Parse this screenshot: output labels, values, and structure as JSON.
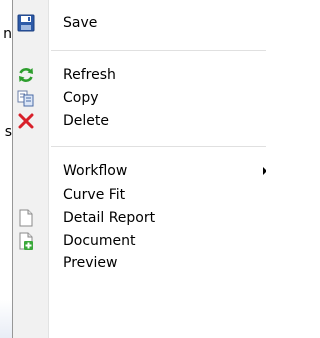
{
  "background": {
    "fragment_1": "n",
    "fragment_2": "s"
  },
  "menu": {
    "items": [
      {
        "label": "Save",
        "icon": "save-disk-icon"
      },
      {
        "label": "Refresh",
        "icon": "refresh-icon"
      },
      {
        "label": "Copy",
        "icon": "copy-icon"
      },
      {
        "label": "Delete",
        "icon": "delete-x-icon"
      },
      {
        "label": "Workflow",
        "icon": "",
        "has_submenu": true
      },
      {
        "label": "Curve Fit",
        "icon": ""
      },
      {
        "label": "Detail Report",
        "icon": "page-icon"
      },
      {
        "label": "Document",
        "icon": "add-document-icon"
      },
      {
        "label": "Preview",
        "icon": ""
      }
    ]
  },
  "colors": {
    "gutter": "#f1f1f1",
    "border": "#979797",
    "separator": "#e0e0e0",
    "refresh_green": "#2e9e2e",
    "delete_red": "#d8202a",
    "save_blue": "#2c5aa8"
  }
}
